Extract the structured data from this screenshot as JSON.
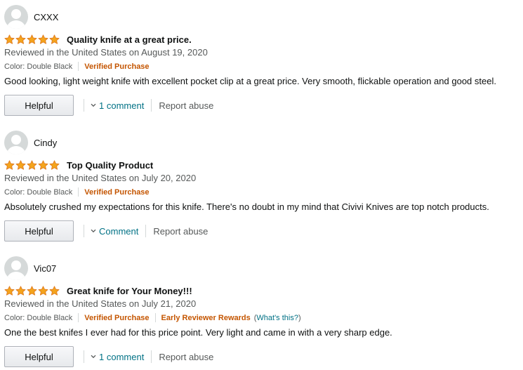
{
  "colors": {
    "star": "#f4a41c",
    "verified": "#c45500",
    "link": "#007185",
    "muted": "#565959"
  },
  "reviews": [
    {
      "reviewer": "CXXX",
      "rating": 5,
      "title": "Quality knife at a great price.",
      "date": "Reviewed in the United States on August 19, 2020",
      "color": "Color: Double Black",
      "verified": "Verified Purchase",
      "body": "Good looking, light weight knife with excellent pocket clip at a great price. Very smooth, flickable operation and good steel.",
      "helpful": "Helpful",
      "comment": "1 comment",
      "report": "Report abuse"
    },
    {
      "reviewer": "Cindy",
      "rating": 5,
      "title": "Top Quality Product",
      "date": "Reviewed in the United States on July 20, 2020",
      "color": "Color: Double Black",
      "verified": "Verified Purchase",
      "body": "Absolutely crushed my expectations for this knife. There's no doubt in my mind that Civivi Knives are top notch products.",
      "helpful": "Helpful",
      "comment": "Comment",
      "report": "Report abuse"
    },
    {
      "reviewer": "Vic07",
      "rating": 5,
      "title": "Great knife for Your Money!!!",
      "date": "Reviewed in the United States on July 21, 2020",
      "color": "Color: Double Black",
      "verified": "Verified Purchase",
      "early_reviewer": "Early Reviewer Rewards",
      "whats_this": "What's this?",
      "body": "One the best knifes I ever had for this price point. Very light and came in with a very sharp edge.",
      "helpful": "Helpful",
      "comment": "1 comment",
      "report": "Report abuse"
    }
  ]
}
